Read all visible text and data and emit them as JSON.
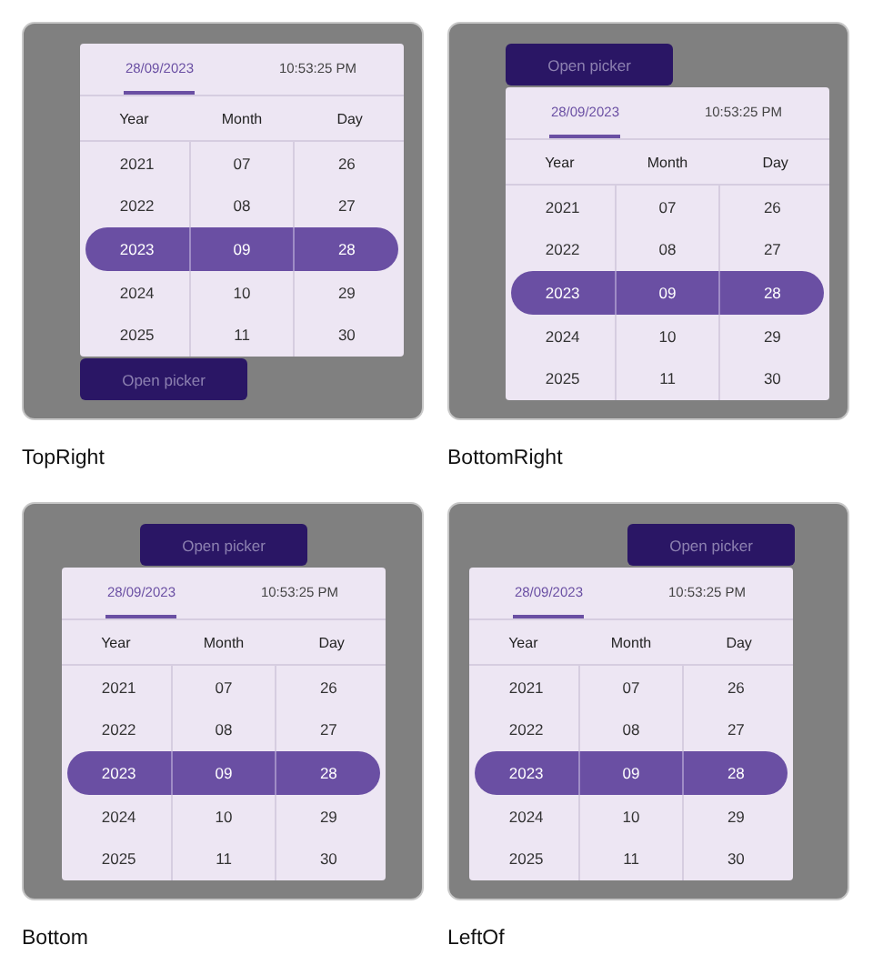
{
  "demos": [
    {
      "label": "TopRight",
      "kind": "top-right",
      "button": "Open picker",
      "tabs": [
        {
          "label": "28/09/2023",
          "selected": true
        },
        {
          "label": "10:53:25 PM",
          "selected": false
        }
      ],
      "columns": [
        "Year",
        "Month",
        "Day"
      ],
      "rows": [
        {
          "cells": [
            "2021",
            "07",
            "26"
          ],
          "selected": false
        },
        {
          "cells": [
            "2022",
            "08",
            "27"
          ],
          "selected": false
        },
        {
          "cells": [
            "2023",
            "09",
            "28"
          ],
          "selected": true
        },
        {
          "cells": [
            "2024",
            "10",
            "29"
          ],
          "selected": false
        },
        {
          "cells": [
            "2025",
            "11",
            "30"
          ],
          "selected": false
        }
      ]
    },
    {
      "label": "BottomRight",
      "kind": "bottom-right",
      "button": "Open picker",
      "tabs": [
        {
          "label": "28/09/2023",
          "selected": true
        },
        {
          "label": "10:53:25 PM",
          "selected": false
        }
      ],
      "columns": [
        "Year",
        "Month",
        "Day"
      ],
      "rows": [
        {
          "cells": [
            "2021",
            "07",
            "26"
          ],
          "selected": false
        },
        {
          "cells": [
            "2022",
            "08",
            "27"
          ],
          "selected": false
        },
        {
          "cells": [
            "2023",
            "09",
            "28"
          ],
          "selected": true
        },
        {
          "cells": [
            "2024",
            "10",
            "29"
          ],
          "selected": false
        },
        {
          "cells": [
            "2025",
            "11",
            "30"
          ],
          "selected": false
        }
      ]
    },
    {
      "label": "Bottom",
      "kind": "bottom",
      "button": "Open picker",
      "tabs": [
        {
          "label": "28/09/2023",
          "selected": true
        },
        {
          "label": "10:53:25 PM",
          "selected": false
        }
      ],
      "columns": [
        "Year",
        "Month",
        "Day"
      ],
      "rows": [
        {
          "cells": [
            "2021",
            "07",
            "26"
          ],
          "selected": false
        },
        {
          "cells": [
            "2022",
            "08",
            "27"
          ],
          "selected": false
        },
        {
          "cells": [
            "2023",
            "09",
            "28"
          ],
          "selected": true
        },
        {
          "cells": [
            "2024",
            "10",
            "29"
          ],
          "selected": false
        },
        {
          "cells": [
            "2025",
            "11",
            "30"
          ],
          "selected": false
        }
      ]
    },
    {
      "label": "LeftOf",
      "kind": "left-of",
      "button": "Open picker",
      "tabs": [
        {
          "label": "28/09/2023",
          "selected": true
        },
        {
          "label": "10:53:25 PM",
          "selected": false
        }
      ],
      "columns": [
        "Year",
        "Month",
        "Day"
      ],
      "rows": [
        {
          "cells": [
            "2021",
            "07",
            "26"
          ],
          "selected": false
        },
        {
          "cells": [
            "2022",
            "08",
            "27"
          ],
          "selected": false
        },
        {
          "cells": [
            "2023",
            "09",
            "28"
          ],
          "selected": true
        },
        {
          "cells": [
            "2024",
            "10",
            "29"
          ],
          "selected": false
        },
        {
          "cells": [
            "2025",
            "11",
            "30"
          ],
          "selected": false
        }
      ]
    }
  ]
}
